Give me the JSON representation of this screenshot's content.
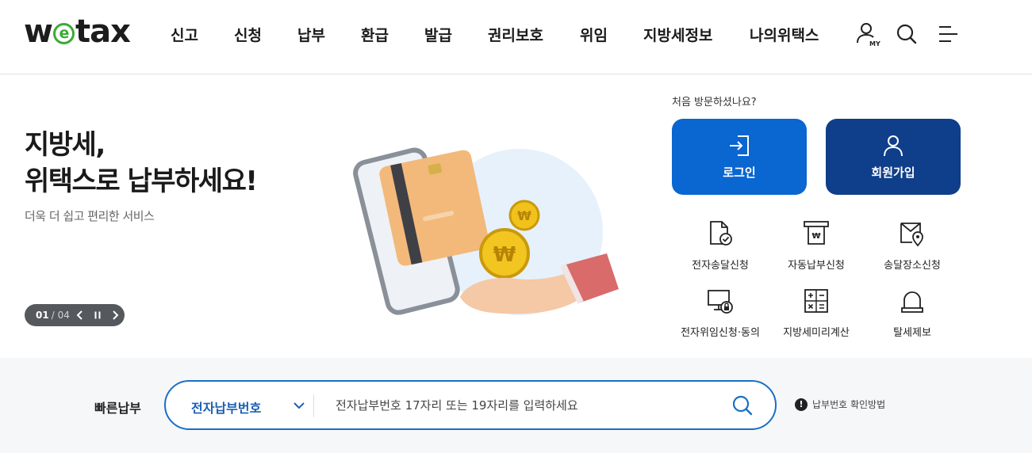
{
  "header": {
    "logo": {
      "pre": "w",
      "mid": "e",
      "post": "tax"
    },
    "nav": [
      "신고",
      "신청",
      "납부",
      "환급",
      "발급",
      "권리보호",
      "위임",
      "지방세정보",
      "나의위택스"
    ],
    "my_label": "MY"
  },
  "hero": {
    "title_line1": "지방세,",
    "title_line2": "위택스로 납부하세요!",
    "subtitle": "더욱 더 쉽고 편리한 서비스",
    "pager_current": "01",
    "pager_sep": " / ",
    "pager_total": "04"
  },
  "member": {
    "prompt": "처음 방문하셨나요?",
    "login_label": "로그인",
    "join_label": "회원가입"
  },
  "services": [
    {
      "label": "전자송달신청",
      "icon": "document-check-icon"
    },
    {
      "label": "자동납부신청",
      "icon": "auto-payment-icon"
    },
    {
      "label": "송달장소신청",
      "icon": "delivery-location-icon"
    },
    {
      "label": "전자위임신청·동의",
      "icon": "computer-lock-icon"
    },
    {
      "label": "지방세미리계산",
      "icon": "calculator-icon"
    },
    {
      "label": "탈세제보",
      "icon": "alarm-bell-icon"
    }
  ],
  "quick_pay": {
    "label": "빠른납부",
    "select_value": "전자납부번호",
    "placeholder": "전자납부번호 17자리 또는 19자리를 입력하세요",
    "help_label": "납부번호 확인방법"
  },
  "colors": {
    "primary": "#0a66d0",
    "navy": "#0f3e8a",
    "logo_green": "#3aaa35"
  }
}
